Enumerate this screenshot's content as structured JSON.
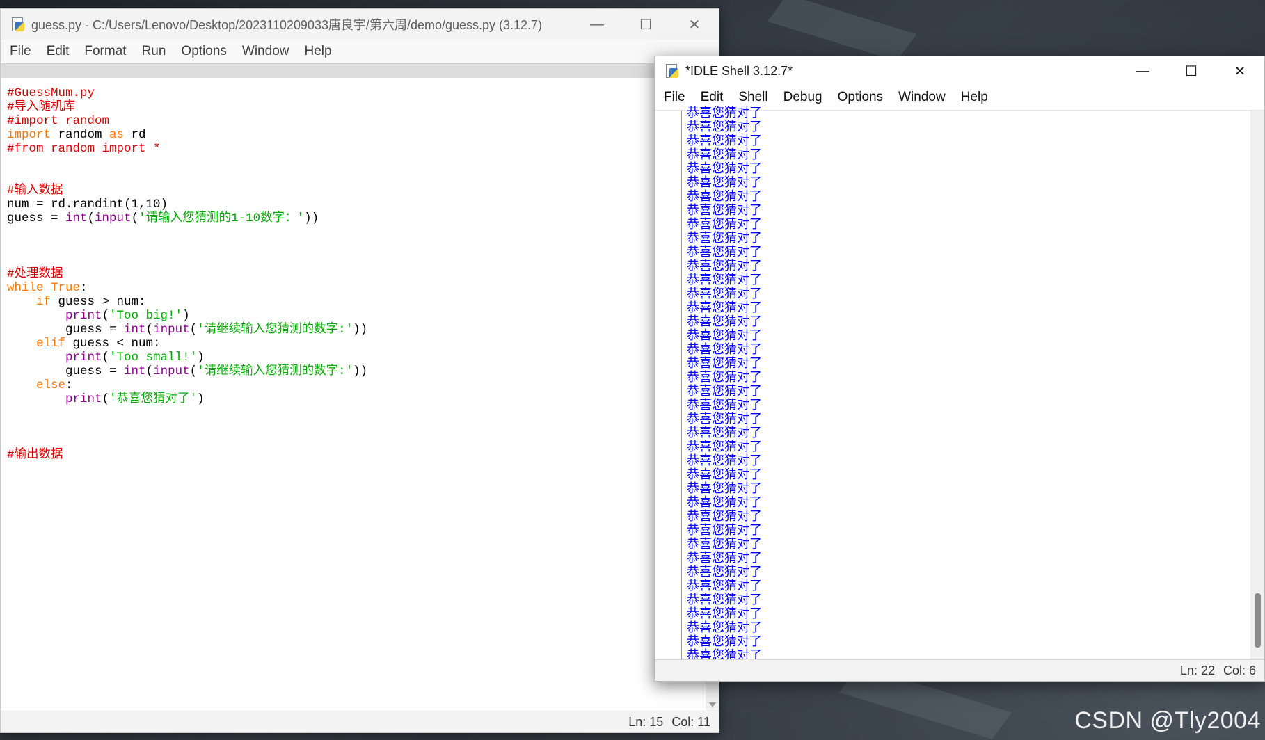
{
  "editor": {
    "title": "guess.py - C:/Users/Lenovo/Desktop/2023110209033唐良宇/第六周/demo/guess.py (3.12.7)",
    "menu": [
      "File",
      "Edit",
      "Format",
      "Run",
      "Options",
      "Window",
      "Help"
    ],
    "window_controls": {
      "minimize": "—",
      "maximize": "☐",
      "close": "✕"
    },
    "code_lines": [
      [
        {
          "t": "cm",
          "v": "#GuessMum.py"
        }
      ],
      [
        {
          "t": "cm",
          "v": "#导入随机库"
        }
      ],
      [
        {
          "t": "cm",
          "v": "#import random"
        }
      ],
      [
        {
          "t": "kw",
          "v": "import"
        },
        {
          "t": "",
          "v": " random "
        },
        {
          "t": "kw",
          "v": "as"
        },
        {
          "t": "",
          "v": " rd"
        }
      ],
      [
        {
          "t": "cm",
          "v": "#from random import *"
        }
      ],
      [],
      [],
      [
        {
          "t": "cm",
          "v": "#输入数据"
        }
      ],
      [
        {
          "t": "",
          "v": "num = rd.randint(1,10)"
        }
      ],
      [
        {
          "t": "",
          "v": "guess = "
        },
        {
          "t": "bi",
          "v": "int"
        },
        {
          "t": "",
          "v": "("
        },
        {
          "t": "bi",
          "v": "input"
        },
        {
          "t": "",
          "v": "("
        },
        {
          "t": "st",
          "v": "'请输入您猜测的1-10数字：'"
        },
        {
          "t": "",
          "v": "))"
        }
      ],
      [],
      [],
      [],
      [
        {
          "t": "cm",
          "v": "#处理数据"
        }
      ],
      [
        {
          "t": "kw",
          "v": "while"
        },
        {
          "t": "",
          "v": " "
        },
        {
          "t": "kw",
          "v": "True"
        },
        {
          "t": "",
          "v": ":"
        }
      ],
      [
        {
          "t": "",
          "v": "    "
        },
        {
          "t": "kw",
          "v": "if"
        },
        {
          "t": "",
          "v": " guess > num:"
        }
      ],
      [
        {
          "t": "",
          "v": "        "
        },
        {
          "t": "bi",
          "v": "print"
        },
        {
          "t": "",
          "v": "("
        },
        {
          "t": "st",
          "v": "'Too big!'"
        },
        {
          "t": "",
          "v": ")"
        }
      ],
      [
        {
          "t": "",
          "v": "        guess = "
        },
        {
          "t": "bi",
          "v": "int"
        },
        {
          "t": "",
          "v": "("
        },
        {
          "t": "bi",
          "v": "input"
        },
        {
          "t": "",
          "v": "("
        },
        {
          "t": "st",
          "v": "'请继续输入您猜测的数字:'"
        },
        {
          "t": "",
          "v": "))"
        }
      ],
      [
        {
          "t": "",
          "v": "    "
        },
        {
          "t": "kw",
          "v": "elif"
        },
        {
          "t": "",
          "v": " guess < num:"
        }
      ],
      [
        {
          "t": "",
          "v": "        "
        },
        {
          "t": "bi",
          "v": "print"
        },
        {
          "t": "",
          "v": "("
        },
        {
          "t": "st",
          "v": "'Too small!'"
        },
        {
          "t": "",
          "v": ")"
        }
      ],
      [
        {
          "t": "",
          "v": "        guess = "
        },
        {
          "t": "bi",
          "v": "int"
        },
        {
          "t": "",
          "v": "("
        },
        {
          "t": "bi",
          "v": "input"
        },
        {
          "t": "",
          "v": "("
        },
        {
          "t": "st",
          "v": "'请继续输入您猜测的数字:'"
        },
        {
          "t": "",
          "v": "))"
        }
      ],
      [
        {
          "t": "",
          "v": "    "
        },
        {
          "t": "kw",
          "v": "else"
        },
        {
          "t": "",
          "v": ":"
        }
      ],
      [
        {
          "t": "",
          "v": "        "
        },
        {
          "t": "bi",
          "v": "print"
        },
        {
          "t": "",
          "v": "("
        },
        {
          "t": "st",
          "v": "'恭喜您猜对了'"
        },
        {
          "t": "",
          "v": ")"
        }
      ],
      [],
      [],
      [],
      [
        {
          "t": "cm",
          "v": "#输出数据"
        }
      ]
    ],
    "status": {
      "ln": "Ln: 15",
      "col": "Col: 11"
    }
  },
  "shell": {
    "title": "*IDLE Shell 3.12.7*",
    "menu": [
      "File",
      "Edit",
      "Shell",
      "Debug",
      "Options",
      "Window",
      "Help"
    ],
    "window_controls": {
      "minimize": "—",
      "maximize": "☐",
      "close": "✕"
    },
    "output_line": "恭喜您猜对了",
    "output_count": 40,
    "status": {
      "ln": "Ln: 22",
      "col": "Col: 6"
    }
  },
  "watermark": "CSDN @Tly2004",
  "colors": {
    "keyword": "#ff7700",
    "comment": "#dd0000",
    "string": "#00aa00",
    "builtin": "#900090",
    "shell_output": "#0000ff"
  }
}
